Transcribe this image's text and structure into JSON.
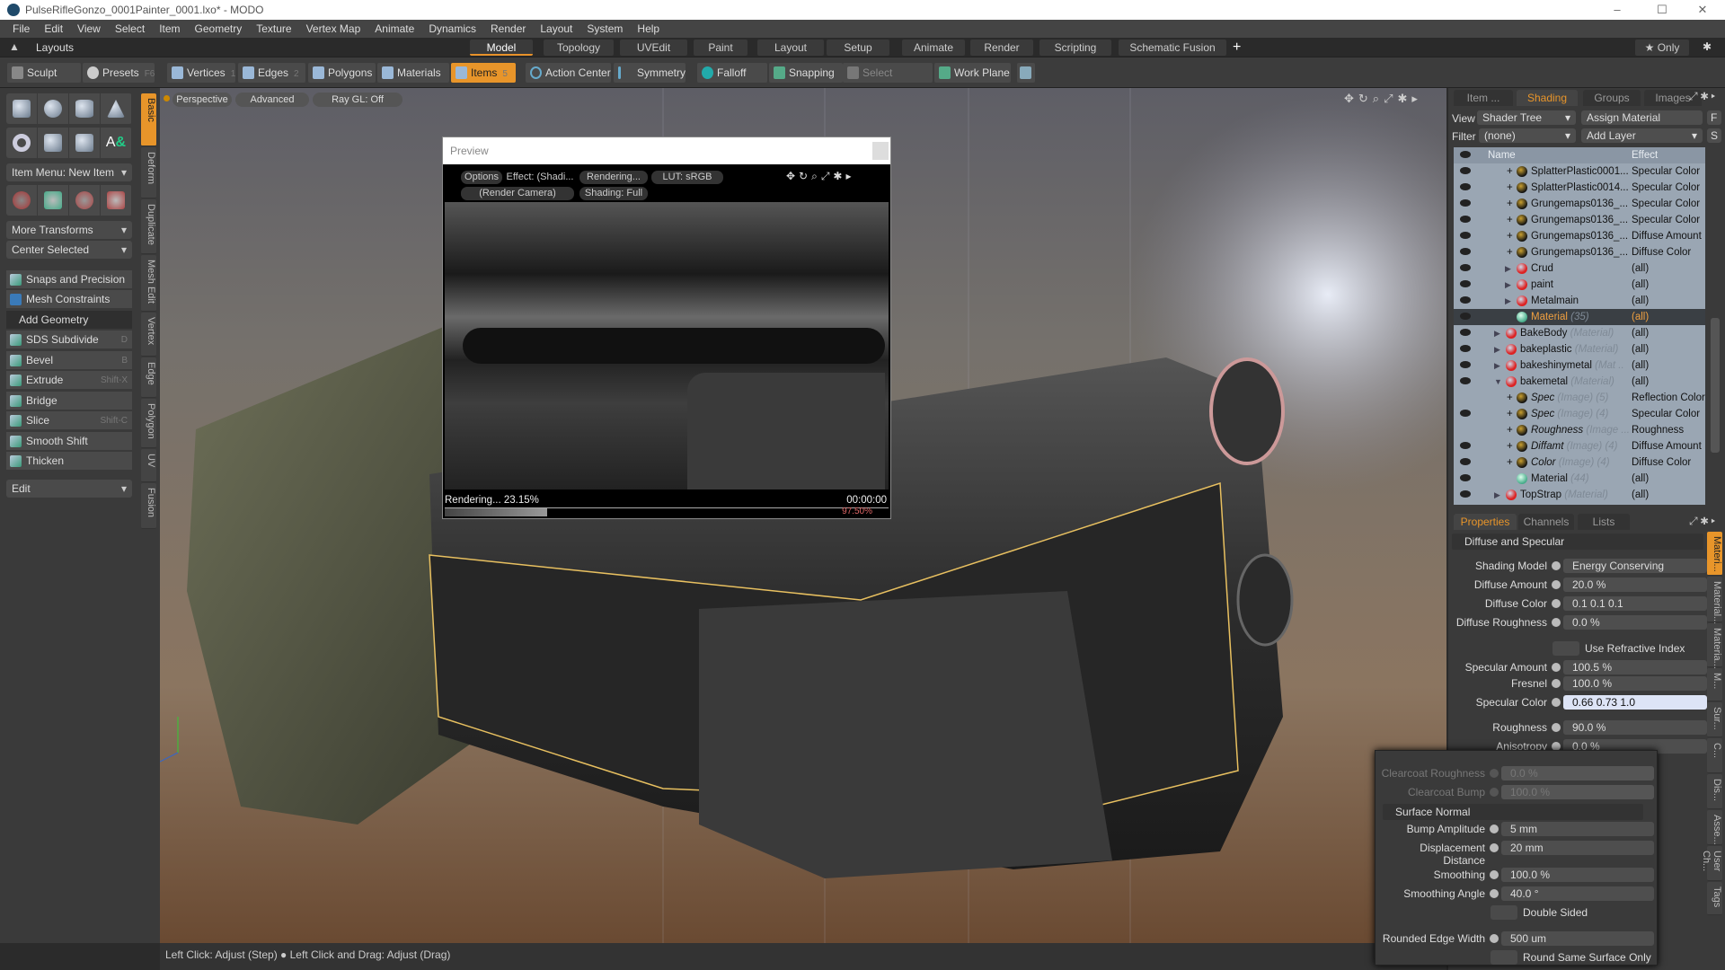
{
  "window": {
    "title": "PulseRifleGonzo_0001Painter_0001.lxo* - MODO",
    "minimize": "–",
    "maximize": "☐",
    "close": "✕"
  },
  "menu": [
    "File",
    "Edit",
    "View",
    "Select",
    "Item",
    "Geometry",
    "Texture",
    "Vertex Map",
    "Animate",
    "Dynamics",
    "Render",
    "Layout",
    "System",
    "Help"
  ],
  "layouts": {
    "label": "Layouts",
    "tabs": [
      "Model",
      "Topology",
      "UVEdit",
      "Paint",
      "Layout",
      "Setup",
      "Animate",
      "Render",
      "Scripting",
      "Schematic Fusion"
    ],
    "active": "Model",
    "add": "+",
    "only": "★ Only"
  },
  "toolbar": {
    "sculpt": "Sculpt",
    "presets": "Presets",
    "presets_key": "F6",
    "items": [
      {
        "label": "Vertices",
        "key": "1"
      },
      {
        "label": "Edges",
        "key": "2"
      },
      {
        "label": "Polygons",
        "key": "3"
      },
      {
        "label": "Materials",
        "key": ""
      },
      {
        "label": "Items",
        "key": "5"
      }
    ],
    "action_center": "Action Center",
    "symmetry": "Symmetry",
    "falloff": "Falloff",
    "snapping": "Snapping",
    "select_through": "Select Through",
    "work_plane": "Work Plane"
  },
  "left": {
    "item_menu": "Item Menu: New Item",
    "more_transforms": "More Transforms",
    "center_selected": "Center Selected",
    "snaps": "Snaps and Precision",
    "constraints": "Mesh Constraints",
    "add_geometry": "Add Geometry",
    "tools": [
      {
        "label": "SDS Subdivide",
        "key": "D"
      },
      {
        "label": "Bevel",
        "key": "B"
      },
      {
        "label": "Extrude",
        "key": "Shift-X"
      },
      {
        "label": "Bridge",
        "key": ""
      },
      {
        "label": "Slice",
        "key": "Shift-C"
      },
      {
        "label": "Smooth Shift",
        "key": ""
      },
      {
        "label": "Thicken",
        "key": ""
      }
    ],
    "edit": "Edit",
    "vtabs": [
      "Basic",
      "Deform",
      "Duplicate",
      "Mesh Edit",
      "Vertex",
      "Edge",
      "Polygon",
      "UV",
      "Fusion"
    ]
  },
  "viewport": {
    "perspective": "Perspective",
    "advanced": "Advanced",
    "raygl": "Ray GL: Off"
  },
  "preview": {
    "title": "Preview",
    "options": "Options",
    "effect": "Effect: (Shadi...",
    "rendering_btn": "Rendering...",
    "lut": "LUT: sRGB",
    "camera": "(Render Camera)",
    "shading": "Shading: Full",
    "status": "Rendering... 23.15%",
    "time": "00:00:00",
    "progress": 23.15,
    "secondary": "97.50%"
  },
  "status": {
    "hint": "Left Click: Adjust (Step) ● Left Click and Drag: Adjust (Drag)"
  },
  "shader": {
    "tabs": [
      "Item ...",
      "Shading",
      "Groups",
      "Images"
    ],
    "active": "Shading",
    "view_label": "View",
    "view": "Shader Tree",
    "assign": "Assign Material",
    "f": "F",
    "filter_label": "Filter",
    "filter": "(none)",
    "add_layer": "Add Layer",
    "s": "S",
    "col_name": "Name",
    "col_effect": "Effect",
    "rows": [
      {
        "name": "SplatterPlastic0001...",
        "sub": "",
        "effect": "Specular Color",
        "type": "image",
        "indent": 3,
        "eye": true
      },
      {
        "name": "SplatterPlastic0014...",
        "sub": "",
        "effect": "Specular Color",
        "type": "image",
        "indent": 3,
        "eye": true
      },
      {
        "name": "Grungemaps0136_...",
        "sub": "",
        "effect": "Specular Color",
        "type": "image",
        "indent": 3,
        "eye": true
      },
      {
        "name": "Grungemaps0136_...",
        "sub": "",
        "effect": "Specular Color",
        "type": "image",
        "indent": 3,
        "eye": true
      },
      {
        "name": "Grungemaps0136_...",
        "sub": "",
        "effect": "Diffuse Amount",
        "type": "image",
        "indent": 3,
        "eye": true
      },
      {
        "name": "Grungemaps0136_...",
        "sub": "",
        "effect": "Diffuse Color",
        "type": "image",
        "indent": 3,
        "eye": true
      },
      {
        "name": "Crud",
        "sub": "",
        "effect": "(all)",
        "type": "mask",
        "indent": 3,
        "eye": true
      },
      {
        "name": "paint",
        "sub": "",
        "effect": "(all)",
        "type": "mask",
        "indent": 3,
        "eye": true
      },
      {
        "name": "Metalmain",
        "sub": "",
        "effect": "(all)",
        "type": "mask",
        "indent": 3,
        "eye": true
      },
      {
        "name": "Material",
        "sub": "(35)",
        "effect": "(all)",
        "type": "material",
        "indent": 3,
        "eye": true,
        "selected": true
      },
      {
        "name": "BakeBody",
        "sub": "(Material)",
        "effect": "(all)",
        "type": "mask",
        "indent": 2,
        "eye": true
      },
      {
        "name": "bakeplastic",
        "sub": "(Material)",
        "effect": "(all)",
        "type": "mask",
        "indent": 2,
        "eye": true
      },
      {
        "name": "bakeshinymetal",
        "sub": "(Mat ...",
        "effect": "(all)",
        "type": "mask",
        "indent": 2,
        "eye": true
      },
      {
        "name": "bakemetal",
        "sub": "(Material)",
        "effect": "(all)",
        "type": "mask",
        "indent": 2,
        "eye": true
      },
      {
        "name": "Spec",
        "sub": "(Image) (5)",
        "effect": "Reflection Color",
        "type": "image",
        "indent": 3,
        "eye": false,
        "italic": true
      },
      {
        "name": "Spec",
        "sub": "(Image) (4)",
        "effect": "Specular Color",
        "type": "image",
        "indent": 3,
        "eye": true,
        "italic": true
      },
      {
        "name": "Roughness",
        "sub": "(Image ...",
        "effect": "Roughness",
        "type": "image",
        "indent": 3,
        "eye": false,
        "italic": true
      },
      {
        "name": "Diffamt",
        "sub": "(Image) (4)",
        "effect": "Diffuse Amount",
        "type": "image",
        "indent": 3,
        "eye": true,
        "italic": true
      },
      {
        "name": "Color",
        "sub": "(Image) (4)",
        "effect": "Diffuse Color",
        "type": "image",
        "indent": 3,
        "eye": true,
        "italic": true
      },
      {
        "name": "Material",
        "sub": "(44)",
        "effect": "(all)",
        "type": "material",
        "indent": 3,
        "eye": true
      },
      {
        "name": "TopStrap",
        "sub": "(Material)",
        "effect": "(all)",
        "type": "mask",
        "indent": 2,
        "eye": true
      }
    ]
  },
  "props": {
    "tabs": [
      "Properties",
      "Channels",
      "Lists"
    ],
    "active": "Properties",
    "vtabs": [
      "Materi...",
      "Material...",
      "Materia...",
      "M...",
      "Sur...",
      "C...",
      "Dis...",
      "Asse...",
      "User Ch...",
      "Tags"
    ],
    "section": "Diffuse and Specular",
    "rows": [
      {
        "label": "Shading Model",
        "value": "Energy Conserving",
        "kind": "dropdown"
      },
      {
        "label": "Diffuse Amount",
        "value": "20.0 %"
      },
      {
        "label": "Diffuse Color",
        "value": "0.1     0.1     0.1"
      },
      {
        "label": "Diffuse Roughness",
        "value": "0.0 %"
      },
      {
        "label": "",
        "value": "Use Refractive Index",
        "kind": "check"
      },
      {
        "label": "Specular Amount",
        "value": "100.5 %"
      },
      {
        "label": "Fresnel",
        "value": "100.0 %"
      },
      {
        "label": "Specular Color",
        "value": "0.66      0.73      1.0",
        "kind": "light"
      },
      {
        "label": "Roughness",
        "value": "90.0 %"
      },
      {
        "label": "Anisotropy",
        "value": "0.0 %"
      }
    ]
  },
  "float": {
    "rows": [
      {
        "label": "Clearcoat Roughness",
        "value": "0.0 %",
        "dim": true
      },
      {
        "label": "Clearcoat Bump",
        "value": "100.0 %",
        "dim": true
      },
      {
        "label": "Surface Normal",
        "kind": "section"
      },
      {
        "label": "Bump Amplitude",
        "value": "5 mm"
      },
      {
        "label": "Displacement Distance",
        "value": "20 mm"
      },
      {
        "label": "Smoothing",
        "value": "100.0 %"
      },
      {
        "label": "Smoothing Angle",
        "value": "40.0 °"
      },
      {
        "label": "",
        "value": "Double Sided",
        "kind": "check"
      },
      {
        "label": "Rounded Edge Width",
        "value": "500 um"
      },
      {
        "label": "",
        "value": "Round Same Surface Only",
        "kind": "check"
      }
    ]
  },
  "colors": {
    "accent": "#e8952a",
    "tree_bg": "#9aa6b3",
    "selection": "#f0a040"
  }
}
